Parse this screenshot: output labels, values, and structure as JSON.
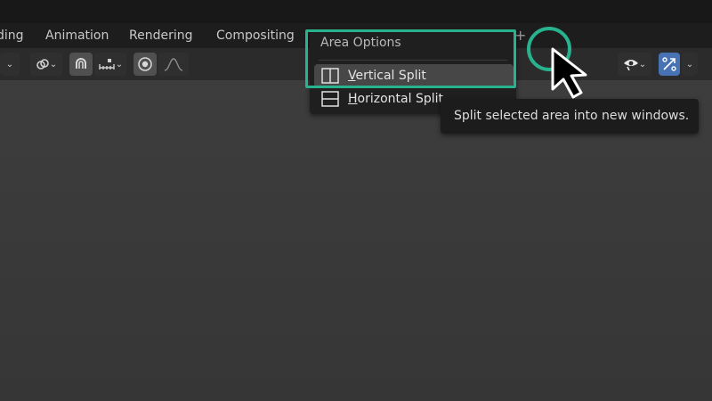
{
  "workspace_tabs": [
    {
      "label": "ding"
    },
    {
      "label": "Animation"
    },
    {
      "label": "Rendering"
    },
    {
      "label": "Compositing"
    }
  ],
  "add_tab_label": "+",
  "area_menu": {
    "title": "Area Options",
    "items": [
      {
        "label_underlined": "V",
        "label_rest": "ertical Split",
        "icon": "vertical-split-icon",
        "hovered": true
      },
      {
        "label_underlined": "H",
        "label_rest": "orizontal Split",
        "icon": "horizontal-split-icon",
        "hovered": false
      }
    ]
  },
  "tooltip": {
    "text": "Split selected area into new windows."
  },
  "toolbar": {
    "icons": [
      "transform-pivot-icon",
      "link-icon",
      "snap-icon",
      "snap-increment-icon",
      "proportional-edit-icon",
      "falloff-curve-icon",
      "visibility-icon",
      "gizmo-icon"
    ]
  },
  "colors": {
    "annotation_accent": "#28b28e",
    "gizmo_button": "#4772b3"
  }
}
